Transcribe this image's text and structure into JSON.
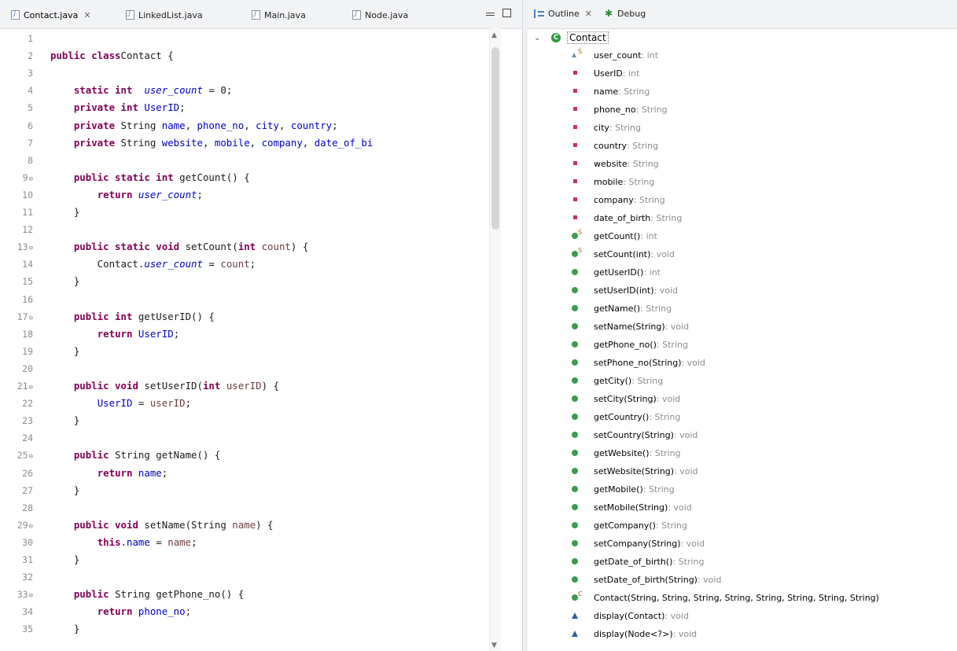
{
  "editor": {
    "tabs": [
      {
        "label": "Contact.java",
        "active": true,
        "closable": true
      },
      {
        "label": "LinkedList.java",
        "active": false,
        "closable": false
      },
      {
        "label": "Main.java",
        "active": false,
        "closable": false
      },
      {
        "label": "Node.java",
        "active": false,
        "closable": false
      }
    ],
    "lines": [
      {
        "n": "1",
        "f": false,
        "t": []
      },
      {
        "n": "2",
        "f": false,
        "t": [
          [
            "kw",
            "public class"
          ],
          [
            "",
            "Contact {"
          ]
        ]
      },
      {
        "n": "3",
        "f": false,
        "t": []
      },
      {
        "n": "4",
        "f": false,
        "t": [
          [
            "",
            "    "
          ],
          [
            "kw",
            "static int"
          ],
          [
            "",
            "  "
          ],
          [
            "sfld",
            "user_count"
          ],
          [
            "",
            " = 0;"
          ]
        ]
      },
      {
        "n": "5",
        "f": false,
        "t": [
          [
            "",
            "    "
          ],
          [
            "kw",
            "private int"
          ],
          [
            "",
            " "
          ],
          [
            "fld",
            "UserID"
          ],
          [
            "",
            ";"
          ]
        ]
      },
      {
        "n": "6",
        "f": false,
        "t": [
          [
            "",
            "    "
          ],
          [
            "kw",
            "private"
          ],
          [
            "",
            " String "
          ],
          [
            "fld",
            "name"
          ],
          [
            "",
            ", "
          ],
          [
            "fld",
            "phone_no"
          ],
          [
            "",
            ", "
          ],
          [
            "fld",
            "city"
          ],
          [
            "",
            ", "
          ],
          [
            "fld",
            "country"
          ],
          [
            "",
            ";"
          ]
        ]
      },
      {
        "n": "7",
        "f": false,
        "t": [
          [
            "",
            "    "
          ],
          [
            "kw",
            "private"
          ],
          [
            "",
            " String "
          ],
          [
            "fld",
            "website"
          ],
          [
            "",
            ", "
          ],
          [
            "fld",
            "mobile"
          ],
          [
            "",
            ", "
          ],
          [
            "fld",
            "company"
          ],
          [
            "",
            ", "
          ],
          [
            "fld",
            "date_of_bi"
          ]
        ]
      },
      {
        "n": "8",
        "f": false,
        "t": []
      },
      {
        "n": "9",
        "f": true,
        "t": [
          [
            "",
            "    "
          ],
          [
            "kw",
            "public static int"
          ],
          [
            "",
            " getCount() {"
          ]
        ]
      },
      {
        "n": "10",
        "f": false,
        "t": [
          [
            "",
            "        "
          ],
          [
            "kw",
            "return"
          ],
          [
            "",
            " "
          ],
          [
            "sfld",
            "user_count"
          ],
          [
            "",
            ";"
          ]
        ]
      },
      {
        "n": "11",
        "f": false,
        "t": [
          [
            "",
            "    }"
          ]
        ]
      },
      {
        "n": "12",
        "f": false,
        "t": []
      },
      {
        "n": "13",
        "f": true,
        "t": [
          [
            "",
            "    "
          ],
          [
            "kw",
            "public static void"
          ],
          [
            "",
            " setCount("
          ],
          [
            "kw",
            "int"
          ],
          [
            "",
            " "
          ],
          [
            "prm",
            "count"
          ],
          [
            "",
            ") {"
          ]
        ]
      },
      {
        "n": "14",
        "f": false,
        "t": [
          [
            "",
            "        Contact."
          ],
          [
            "sfld",
            "user_count"
          ],
          [
            "",
            " = "
          ],
          [
            "prm",
            "count"
          ],
          [
            "",
            ";"
          ]
        ]
      },
      {
        "n": "15",
        "f": false,
        "t": [
          [
            "",
            "    }"
          ]
        ]
      },
      {
        "n": "16",
        "f": false,
        "t": []
      },
      {
        "n": "17",
        "f": true,
        "t": [
          [
            "",
            "    "
          ],
          [
            "kw",
            "public int"
          ],
          [
            "",
            " getUserID() {"
          ]
        ]
      },
      {
        "n": "18",
        "f": false,
        "t": [
          [
            "",
            "        "
          ],
          [
            "kw",
            "return"
          ],
          [
            "",
            " "
          ],
          [
            "fld",
            "UserID"
          ],
          [
            "",
            ";"
          ]
        ]
      },
      {
        "n": "19",
        "f": false,
        "t": [
          [
            "",
            "    }"
          ]
        ]
      },
      {
        "n": "20",
        "f": false,
        "t": []
      },
      {
        "n": "21",
        "f": true,
        "t": [
          [
            "",
            "    "
          ],
          [
            "kw",
            "public void"
          ],
          [
            "",
            " setUserID("
          ],
          [
            "kw",
            "int"
          ],
          [
            "",
            " "
          ],
          [
            "prm",
            "userID"
          ],
          [
            "",
            ") {"
          ]
        ]
      },
      {
        "n": "22",
        "f": false,
        "t": [
          [
            "",
            "        "
          ],
          [
            "fld",
            "UserID"
          ],
          [
            "",
            " = "
          ],
          [
            "prm",
            "userID"
          ],
          [
            "",
            ";"
          ]
        ]
      },
      {
        "n": "23",
        "f": false,
        "t": [
          [
            "",
            "    }"
          ]
        ]
      },
      {
        "n": "24",
        "f": false,
        "t": []
      },
      {
        "n": "25",
        "f": true,
        "t": [
          [
            "",
            "    "
          ],
          [
            "kw",
            "public"
          ],
          [
            "",
            " String getName() {"
          ]
        ]
      },
      {
        "n": "26",
        "f": false,
        "t": [
          [
            "",
            "        "
          ],
          [
            "kw",
            "return"
          ],
          [
            "",
            " "
          ],
          [
            "fld",
            "name"
          ],
          [
            "",
            ";"
          ]
        ]
      },
      {
        "n": "27",
        "f": false,
        "t": [
          [
            "",
            "    }"
          ]
        ]
      },
      {
        "n": "28",
        "f": false,
        "t": []
      },
      {
        "n": "29",
        "f": true,
        "t": [
          [
            "",
            "    "
          ],
          [
            "kw",
            "public void"
          ],
          [
            "",
            " setName(String "
          ],
          [
            "prm",
            "name"
          ],
          [
            "",
            ") {"
          ]
        ]
      },
      {
        "n": "30",
        "f": false,
        "t": [
          [
            "",
            "        "
          ],
          [
            "kw",
            "this"
          ],
          [
            "",
            "."
          ],
          [
            "fld",
            "name"
          ],
          [
            "",
            " = "
          ],
          [
            "prm",
            "name"
          ],
          [
            "",
            ";"
          ]
        ]
      },
      {
        "n": "31",
        "f": false,
        "t": [
          [
            "",
            "    }"
          ]
        ]
      },
      {
        "n": "32",
        "f": false,
        "t": []
      },
      {
        "n": "33",
        "f": true,
        "t": [
          [
            "",
            "    "
          ],
          [
            "kw",
            "public"
          ],
          [
            "",
            " String getPhone_no() {"
          ]
        ]
      },
      {
        "n": "34",
        "f": false,
        "t": [
          [
            "",
            "        "
          ],
          [
            "kw",
            "return"
          ],
          [
            "",
            " "
          ],
          [
            "fld",
            "phone_no"
          ],
          [
            "",
            ";"
          ]
        ]
      },
      {
        "n": "35",
        "f": false,
        "t": [
          [
            "",
            "    }"
          ]
        ]
      }
    ]
  },
  "outline": {
    "tabs": [
      {
        "label": "Outline",
        "icon": "outline-icon",
        "closable": true
      },
      {
        "label": "Debug",
        "icon": "debug-icon",
        "closable": false
      }
    ],
    "root": {
      "label": "Contact",
      "icon": "class-icon"
    },
    "items": [
      {
        "label": "user_count",
        "type": "int",
        "icon": "pkg",
        "mod": "S"
      },
      {
        "label": "UserID",
        "type": "int",
        "icon": "priv",
        "mod": ""
      },
      {
        "label": "name",
        "type": "String",
        "icon": "priv",
        "mod": ""
      },
      {
        "label": "phone_no",
        "type": "String",
        "icon": "priv",
        "mod": ""
      },
      {
        "label": "city",
        "type": "String",
        "icon": "priv",
        "mod": ""
      },
      {
        "label": "country",
        "type": "String",
        "icon": "priv",
        "mod": ""
      },
      {
        "label": "website",
        "type": "String",
        "icon": "priv",
        "mod": ""
      },
      {
        "label": "mobile",
        "type": "String",
        "icon": "priv",
        "mod": ""
      },
      {
        "label": "company",
        "type": "String",
        "icon": "priv",
        "mod": ""
      },
      {
        "label": "date_of_birth",
        "type": "String",
        "icon": "priv",
        "mod": ""
      },
      {
        "label": "getCount()",
        "type": "int",
        "icon": "pub",
        "mod": "S"
      },
      {
        "label": "setCount(int)",
        "type": "void",
        "icon": "pub",
        "mod": "S"
      },
      {
        "label": "getUserID()",
        "type": "int",
        "icon": "pub",
        "mod": ""
      },
      {
        "label": "setUserID(int)",
        "type": "void",
        "icon": "pub",
        "mod": ""
      },
      {
        "label": "getName()",
        "type": "String",
        "icon": "pub",
        "mod": ""
      },
      {
        "label": "setName(String)",
        "type": "void",
        "icon": "pub",
        "mod": ""
      },
      {
        "label": "getPhone_no()",
        "type": "String",
        "icon": "pub",
        "mod": ""
      },
      {
        "label": "setPhone_no(String)",
        "type": "void",
        "icon": "pub",
        "mod": ""
      },
      {
        "label": "getCity()",
        "type": "String",
        "icon": "pub",
        "mod": ""
      },
      {
        "label": "setCity(String)",
        "type": "void",
        "icon": "pub",
        "mod": ""
      },
      {
        "label": "getCountry()",
        "type": "String",
        "icon": "pub",
        "mod": ""
      },
      {
        "label": "setCountry(String)",
        "type": "void",
        "icon": "pub",
        "mod": ""
      },
      {
        "label": "getWebsite()",
        "type": "String",
        "icon": "pub",
        "mod": ""
      },
      {
        "label": "setWebsite(String)",
        "type": "void",
        "icon": "pub",
        "mod": ""
      },
      {
        "label": "getMobile()",
        "type": "String",
        "icon": "pub",
        "mod": ""
      },
      {
        "label": "setMobile(String)",
        "type": "void",
        "icon": "pub",
        "mod": ""
      },
      {
        "label": "getCompany()",
        "type": "String",
        "icon": "pub",
        "mod": ""
      },
      {
        "label": "setCompany(String)",
        "type": "void",
        "icon": "pub",
        "mod": ""
      },
      {
        "label": "getDate_of_birth()",
        "type": "String",
        "icon": "pub",
        "mod": ""
      },
      {
        "label": "setDate_of_birth(String)",
        "type": "void",
        "icon": "pub",
        "mod": ""
      },
      {
        "label": "Contact(String, String, String, String, String, String, String, String)",
        "type": "",
        "icon": "pub",
        "mod": "C"
      },
      {
        "label": "display(Contact)",
        "type": "void",
        "icon": "def",
        "mod": ""
      },
      {
        "label": "display(Node<?>)",
        "type": "void",
        "icon": "def",
        "mod": ""
      }
    ]
  }
}
